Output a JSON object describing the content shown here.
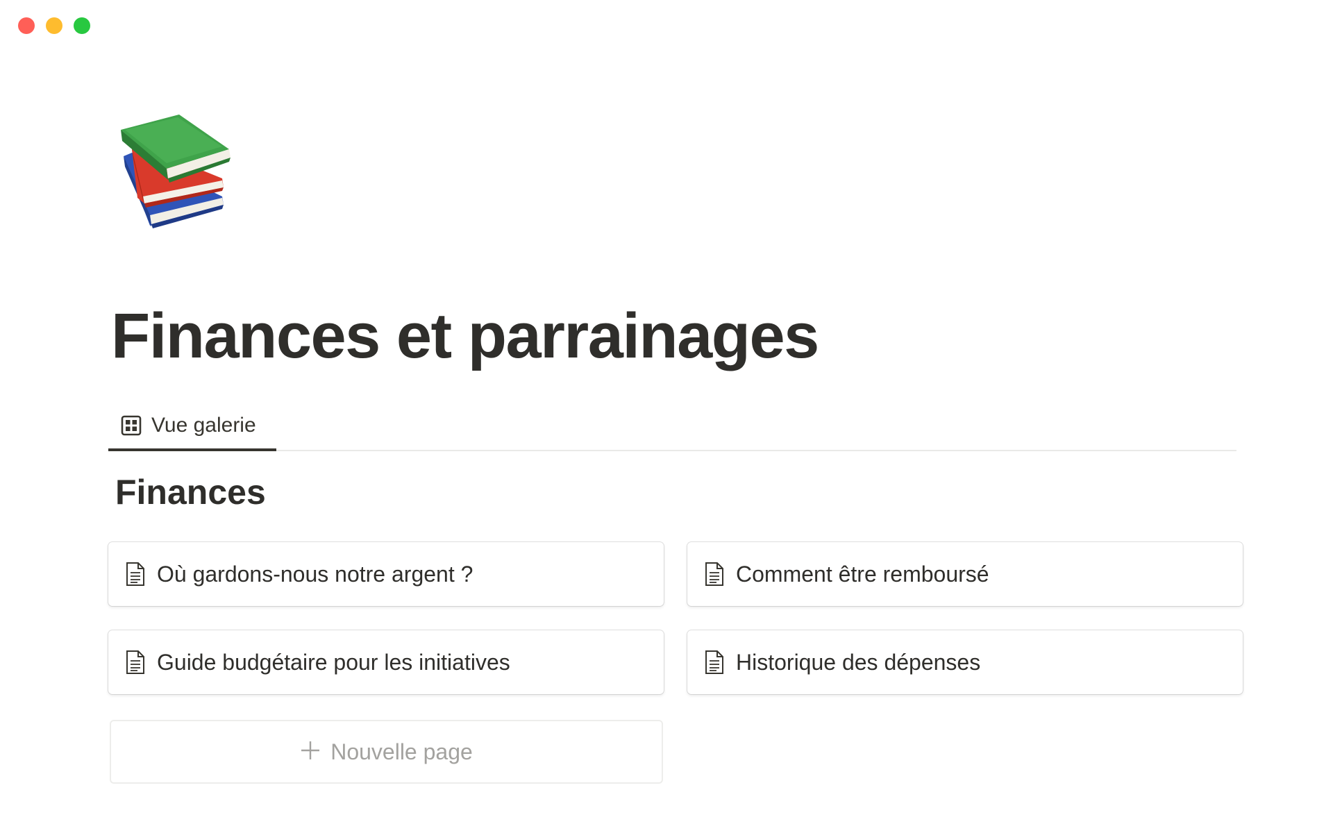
{
  "window": {
    "controls": [
      "close",
      "minimize",
      "maximize"
    ],
    "colors": {
      "close": "#ff5f57",
      "minimize": "#febc2e",
      "maximize": "#28c840"
    }
  },
  "page": {
    "icon": "books-emoji-icon",
    "title": "Finances et parrainages"
  },
  "tabs": [
    {
      "label": "Vue galerie",
      "icon": "gallery-grid-icon",
      "active": true
    }
  ],
  "section": {
    "title": "Finances"
  },
  "cards": [
    {
      "label": "Où gardons-nous notre argent ?",
      "icon": "document-icon"
    },
    {
      "label": "Comment être remboursé",
      "icon": "document-icon"
    },
    {
      "label": "Guide budgétaire pour les initiatives",
      "icon": "document-icon"
    },
    {
      "label": "Historique des dépenses",
      "icon": "document-icon"
    }
  ],
  "new_page": {
    "label": "Nouvelle page",
    "icon": "plus-icon"
  }
}
